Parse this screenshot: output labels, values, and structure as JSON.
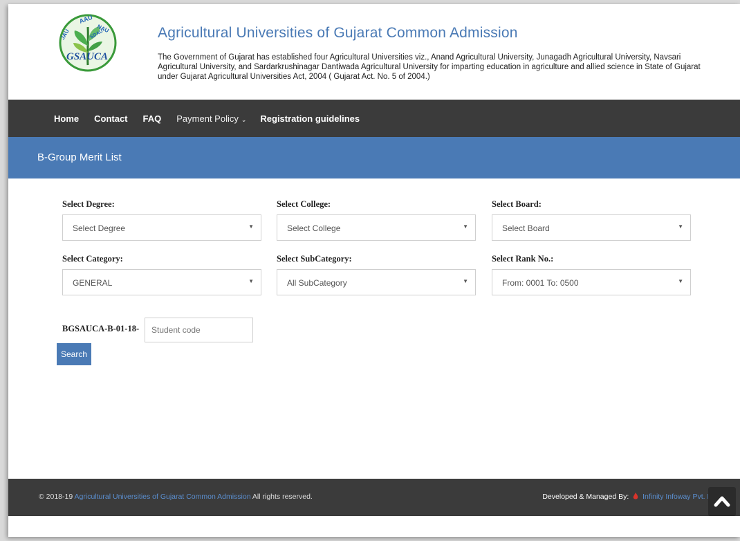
{
  "header": {
    "logo_text": "GSAUCA",
    "logo_badges": [
      "AAU",
      "NAU",
      "JAU",
      "SDAU"
    ],
    "title": "Agricultural Universities of Gujarat Common Admission",
    "description": "The Government of Gujarat has established four Agricultural Universities viz., Anand Agricultural University, Junagadh Agricultural University, Navsari Agricultural University, and Sardarkrushinagar Dantiwada Agricultural University for imparting education in agriculture and allied science in State of Gujarat under Gujarat Agricultural Universities Act, 2004 ( Gujarat Act. No. 5 of 2004.)"
  },
  "nav": {
    "items": [
      {
        "label": "Home"
      },
      {
        "label": "Contact"
      },
      {
        "label": "FAQ"
      },
      {
        "label": "Payment Policy"
      },
      {
        "label": "Registration guidelines"
      }
    ]
  },
  "page_title": "B-Group Merit List",
  "form": {
    "degree": {
      "label": "Select Degree:",
      "value": "Select Degree"
    },
    "college": {
      "label": "Select College:",
      "value": "Select College"
    },
    "board": {
      "label": "Select Board:",
      "value": "Select Board"
    },
    "category": {
      "label": "Select Category:",
      "value": "GENERAL"
    },
    "subcategory": {
      "label": "Select SubCategory:",
      "value": "All SubCategory"
    },
    "rank": {
      "label": "Select Rank No.:",
      "value": "From: 0001 To: 0500"
    },
    "code_prefix": "BGSAUCA-B-01-18-",
    "student_code_placeholder": "Student code",
    "search_label": "Search"
  },
  "footer": {
    "copyright_prefix": "© 2018-19",
    "site_link": "Agricultural Universities of Gujarat Common Admission",
    "rights": "All rights reserved.",
    "developed_by": "Developed & Managed By:",
    "company": "Infinity Infoway Pvt. Ltd."
  },
  "colors": {
    "brand_blue": "#4a7ab5",
    "nav_dark": "#3b3b3b",
    "logo_green": "#3a9a3a"
  },
  "icons": {
    "dropdown": "chevron-down-icon",
    "scroll_top": "chevron-up-icon"
  }
}
